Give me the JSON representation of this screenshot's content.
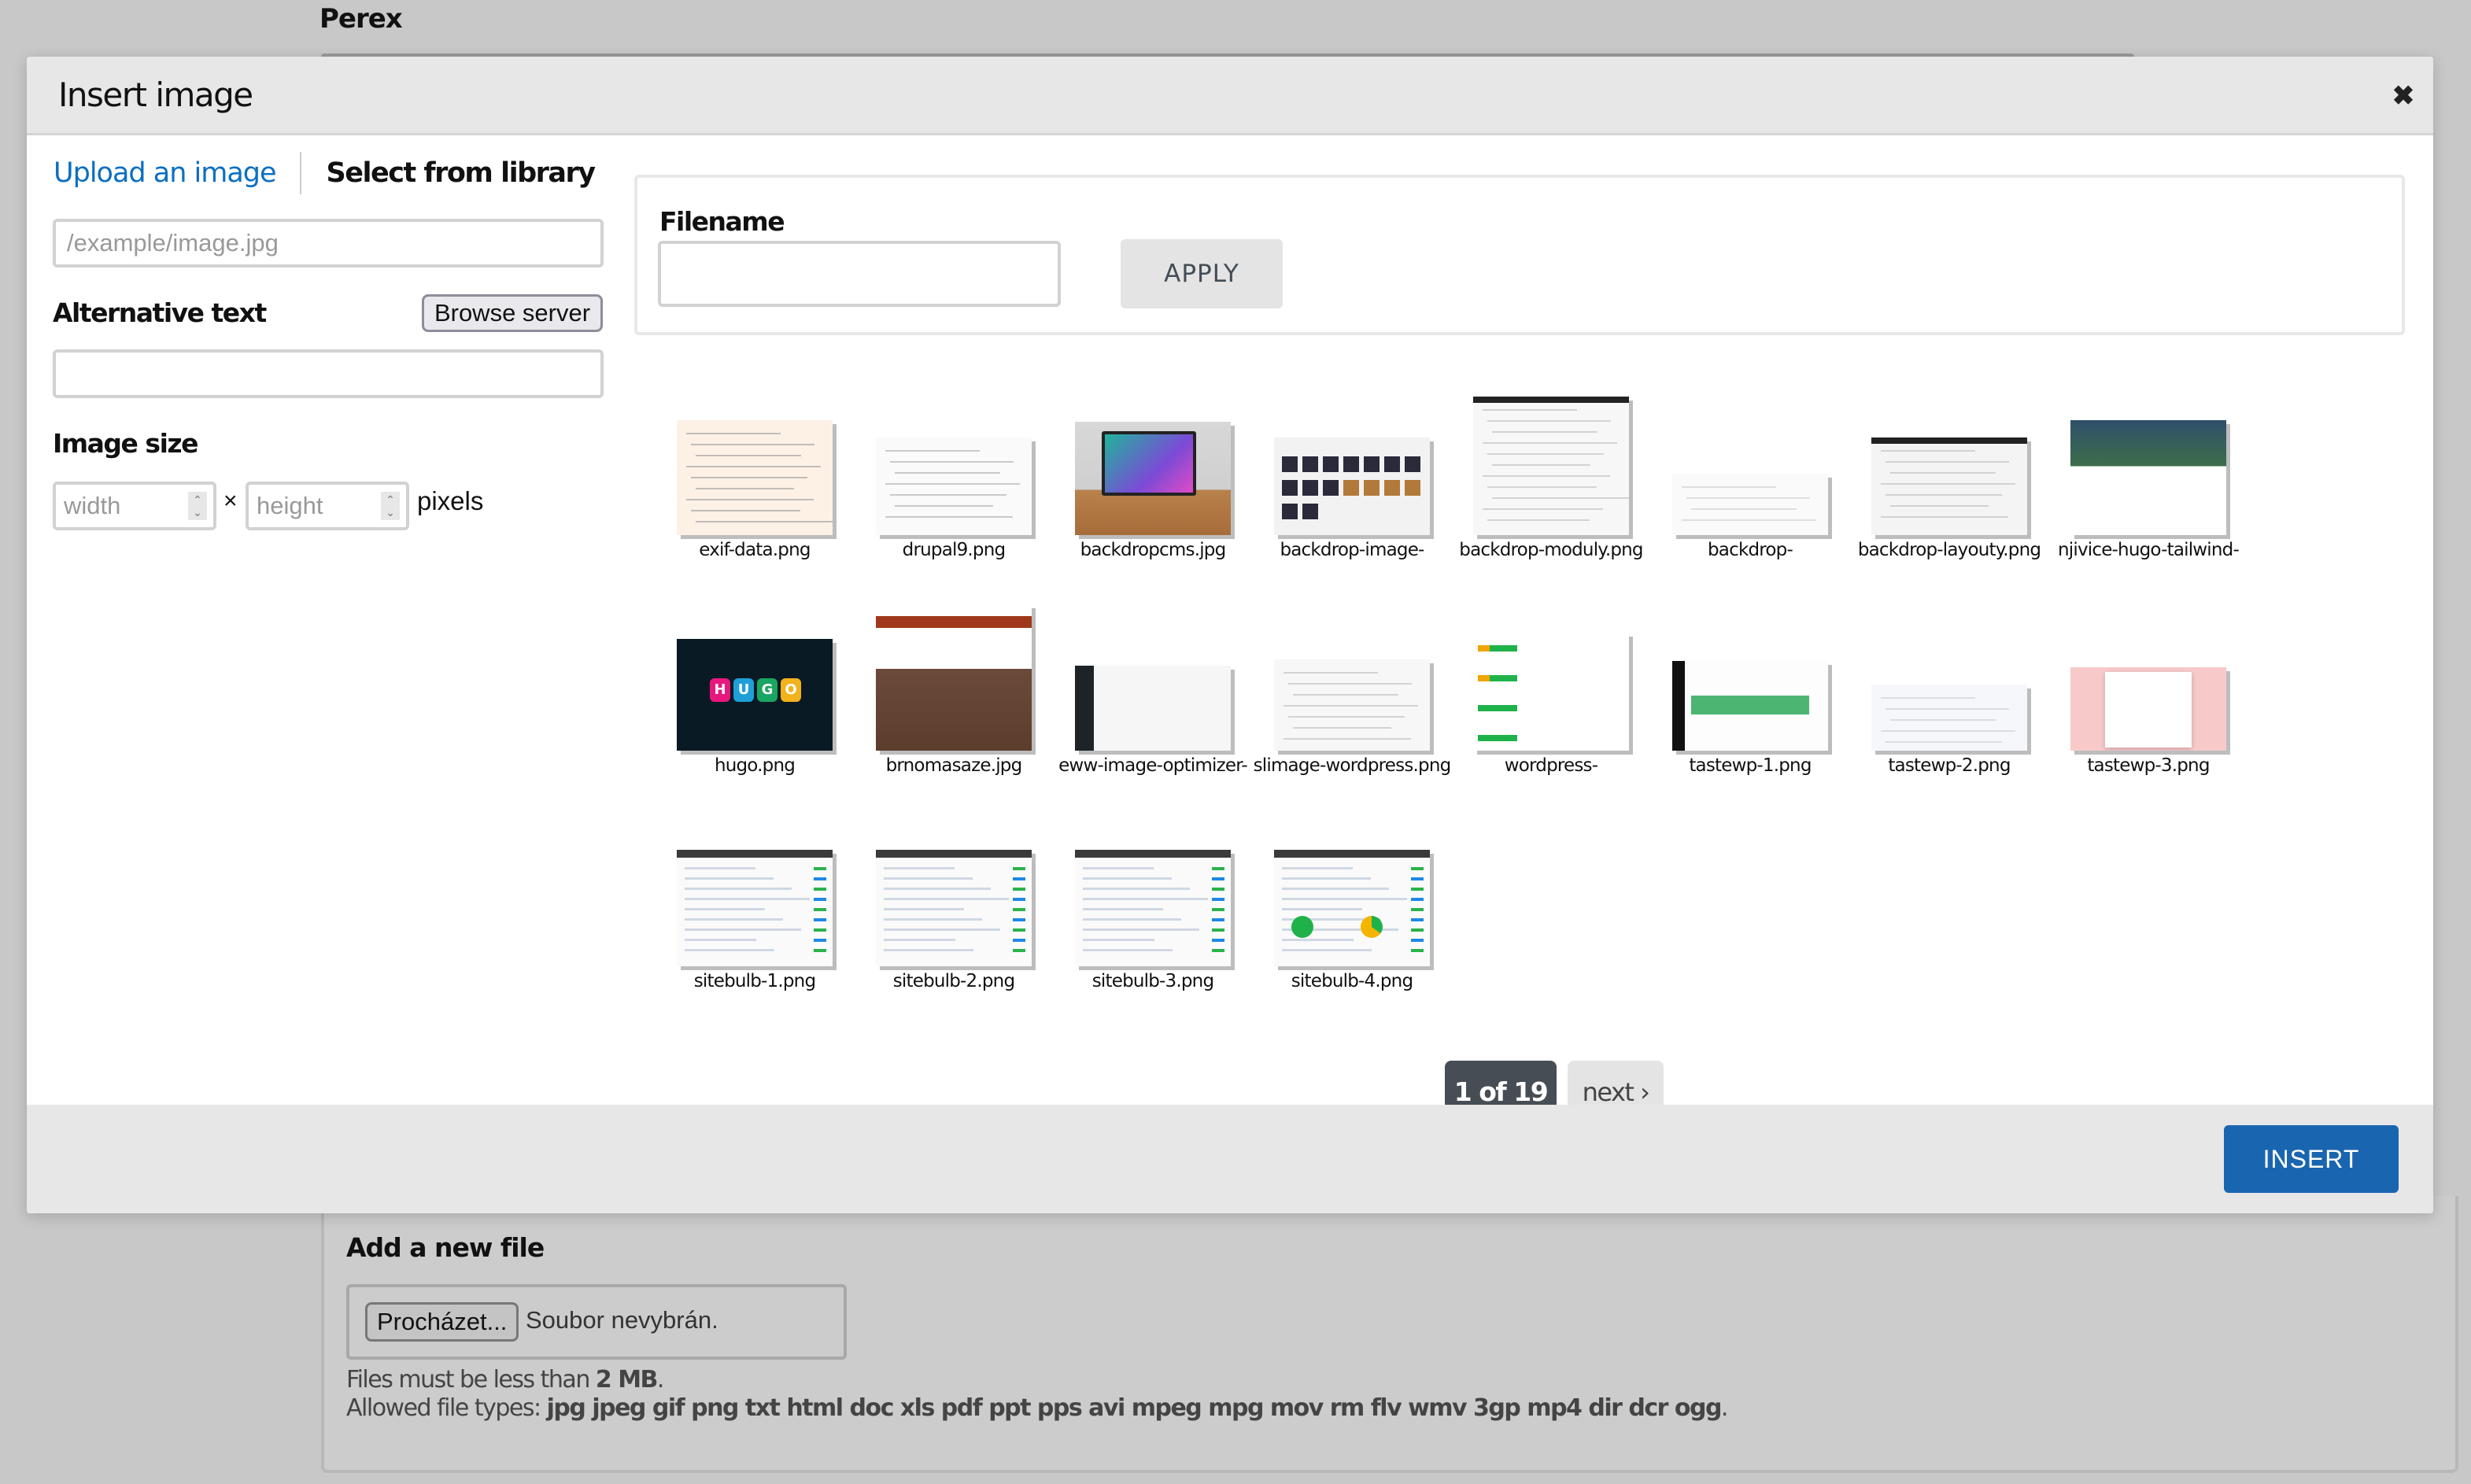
{
  "background": {
    "perex_label": "Perex",
    "add_file": {
      "title": "Add a new file",
      "browse_button": "Procházet...",
      "file_status": "Soubor nevybrán.",
      "size_text": "Files must be less than ",
      "size_value": "2 MB",
      "size_suffix": ".",
      "types_text": "Allowed file types: ",
      "types_value": "jpg jpeg gif png txt html doc xls pdf ppt pps avi mpeg mpg mov rm flv wmv 3gp mp4 dir dcr ogg",
      "types_suffix": "."
    }
  },
  "dialog": {
    "title": "Insert image",
    "close_icon": "close-icon",
    "tabs": {
      "upload": "Upload an image",
      "library": "Select from library",
      "active": "library"
    },
    "url_input": {
      "value": "",
      "placeholder": "/example/image.jpg"
    },
    "alt_text": {
      "label": "Alternative text",
      "browse_button": "Browse server",
      "value": ""
    },
    "image_size": {
      "label": "Image size",
      "width_placeholder": "width",
      "height_placeholder": "height",
      "times": "×",
      "unit": "pixels"
    },
    "filter": {
      "label": "Filename",
      "value": "",
      "apply_button": "APPLY"
    },
    "images": [
      {
        "name": "exif-data.png",
        "style": "exif"
      },
      {
        "name": "drupal9.png",
        "style": "drupal"
      },
      {
        "name": "backdropcms.jpg",
        "style": "monitor"
      },
      {
        "name": "backdrop-image-",
        "style": "gallery"
      },
      {
        "name": "backdrop-moduly.png",
        "style": "tall-admin"
      },
      {
        "name": "backdrop-",
        "style": "wide-admin"
      },
      {
        "name": "backdrop-layouty.png",
        "style": "layouts"
      },
      {
        "name": "njivice-hugo-tailwind-",
        "style": "landscape"
      },
      {
        "name": "hugo.png",
        "style": "hugo"
      },
      {
        "name": "brnomasaze.jpg",
        "style": "massage"
      },
      {
        "name": "eww-image-optimizer-",
        "style": "wp-dark"
      },
      {
        "name": "slimage-wordpress.png",
        "style": "wp-form"
      },
      {
        "name": "wordpress-",
        "style": "seo-table"
      },
      {
        "name": "tastewp-1.png",
        "style": "tastewp1"
      },
      {
        "name": "tastewp-2.png",
        "style": "tastewp2"
      },
      {
        "name": "tastewp-3.png",
        "style": "tastewp3"
      },
      {
        "name": "sitebulb-1.png",
        "style": "sitebulb1"
      },
      {
        "name": "sitebulb-2.png",
        "style": "sitebulb2"
      },
      {
        "name": "sitebulb-3.png",
        "style": "sitebulb3"
      },
      {
        "name": "sitebulb-4.png",
        "style": "sitebulb4"
      }
    ],
    "pager": {
      "current": 1,
      "total": 19,
      "current_label": "1 of 19",
      "next_label": "next ›"
    },
    "insert_button": "INSERT"
  },
  "colors": {
    "accent": "#1a65b0",
    "link": "#0a6fc2",
    "pager_active": "#474d54",
    "overlay": "#c8c8c8"
  }
}
